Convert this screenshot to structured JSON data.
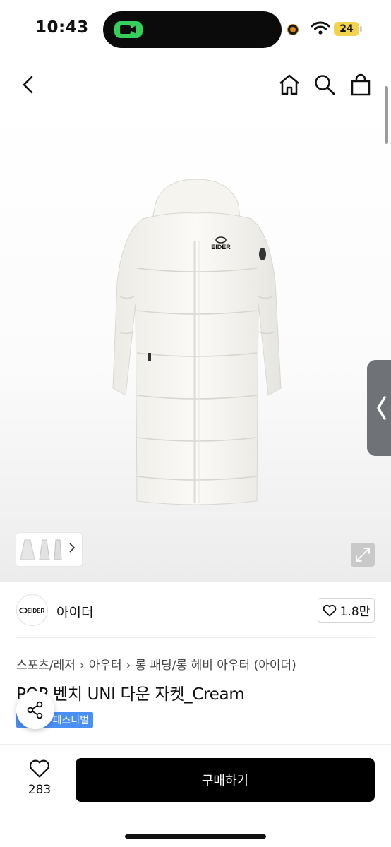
{
  "status_bar": {
    "time": "10:43",
    "battery": "24"
  },
  "nav": {
    "icons": [
      "back-icon",
      "home-icon",
      "search-icon",
      "bag-icon"
    ]
  },
  "product_image": {
    "logo_text": "EIDER"
  },
  "brand": {
    "logo_text": "EIDER",
    "name": "아이더",
    "likes": "1.8만"
  },
  "breadcrumb": [
    "스포츠/레저",
    "아우터",
    "롱 패딩/롱 헤비 아우터 (아이더)"
  ],
  "product": {
    "title": "POP 벤치 UNI 다운 자켓_Cream",
    "badge": "페스티벌"
  },
  "bottom_bar": {
    "wish_count": "283",
    "buy_label": "구매하기"
  },
  "colors": {
    "primary_button": "#000000",
    "badge": "#4a8ff5",
    "side_tab": "#6f7378"
  }
}
